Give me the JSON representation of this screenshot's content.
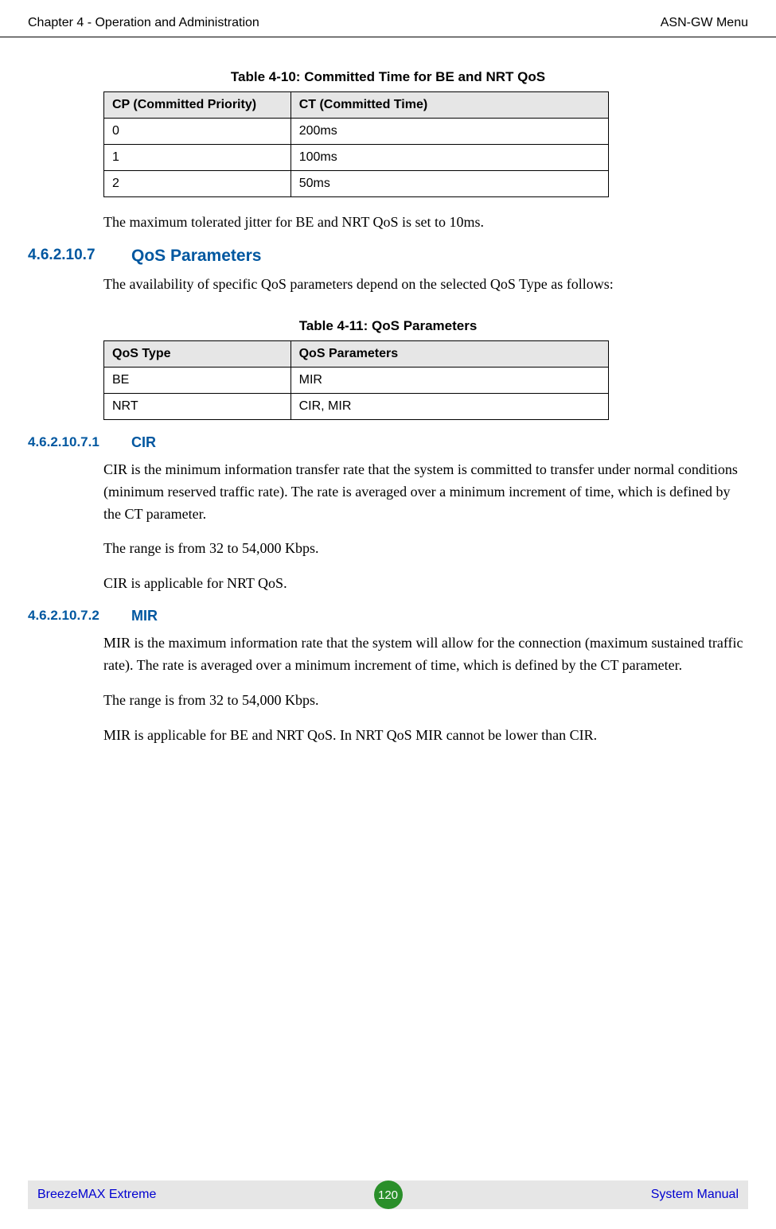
{
  "header": {
    "left": "Chapter 4 - Operation and Administration",
    "right": "ASN-GW Menu"
  },
  "table410": {
    "caption": "Table 4-10: Committed Time for BE and NRT QoS",
    "headers": {
      "c1": "CP (Committed Priority)",
      "c2": "CT (Committed Time)"
    },
    "rows": [
      {
        "c1": "0",
        "c2": "200ms"
      },
      {
        "c1": "1",
        "c2": "100ms"
      },
      {
        "c1": "2",
        "c2": "50ms"
      }
    ]
  },
  "jitter_text": "The maximum tolerated jitter for BE and NRT QoS is set to 10ms.",
  "sec_qos": {
    "num": "4.6.2.10.7",
    "title": "QoS Parameters",
    "intro": "The availability of specific QoS parameters depend on the selected QoS Type as follows:"
  },
  "table411": {
    "caption": "Table 4-11: QoS Parameters",
    "headers": {
      "c1": "QoS Type",
      "c2": "QoS Parameters"
    },
    "rows": [
      {
        "c1": "BE",
        "c2": "MIR"
      },
      {
        "c1": "NRT",
        "c2": "CIR, MIR"
      }
    ]
  },
  "sec_cir": {
    "num": "4.6.2.10.7.1",
    "title": "CIR",
    "p1": "CIR is the minimum information transfer rate that the system is committed to transfer under normal conditions (minimum reserved traffic rate). The rate is averaged over a minimum increment of time, which is defined by the CT parameter.",
    "p2": "The range is from 32 to 54,000 Kbps.",
    "p3": "CIR is applicable for NRT QoS."
  },
  "sec_mir": {
    "num": "4.6.2.10.7.2",
    "title": "MIR",
    "p1": "MIR is the maximum information rate that the system will allow for the connection (maximum sustained traffic rate). The rate is averaged over a minimum increment of time, which is defined by the CT parameter.",
    "p2": "The range is from 32 to 54,000 Kbps.",
    "p3": "MIR is applicable for BE and NRT QoS. In NRT QoS MIR cannot be lower than CIR."
  },
  "footer": {
    "left": "BreezeMAX Extreme",
    "page": "120",
    "right": "System Manual"
  }
}
